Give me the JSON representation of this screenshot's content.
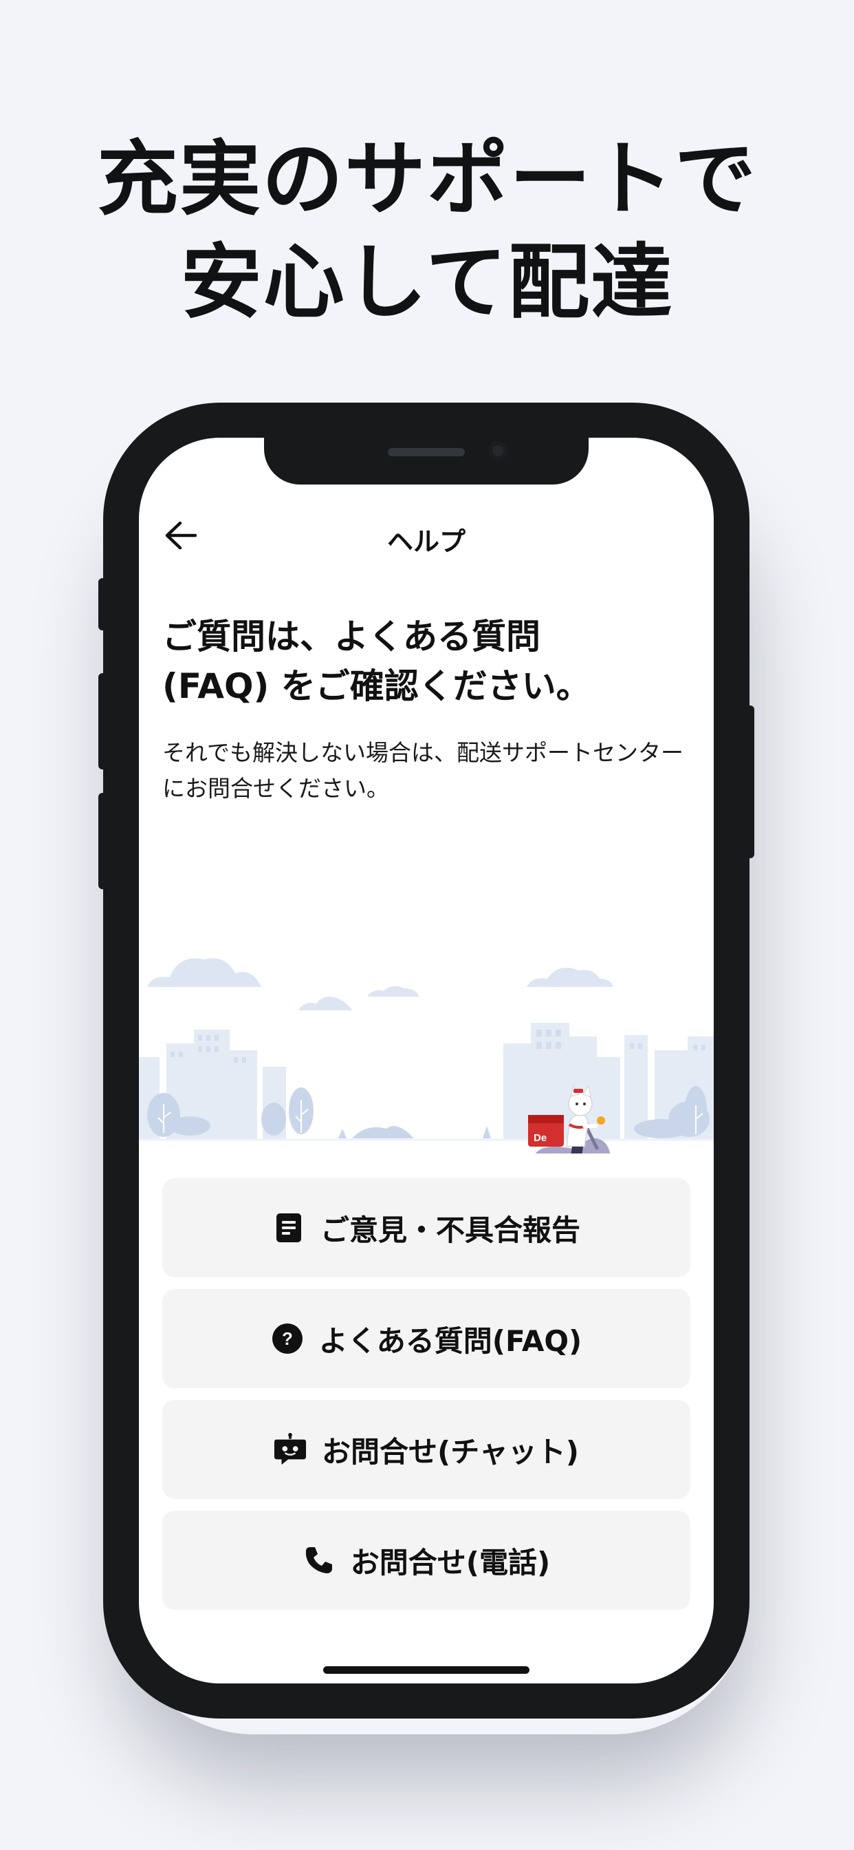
{
  "headline": {
    "line1": "充実のサポートで",
    "line2": "安心して配達"
  },
  "nav": {
    "back_icon": "arrow-left-icon",
    "title": "ヘルプ"
  },
  "content": {
    "heading": "ご質問は、よくある質問\n(FAQ) をご確認ください。",
    "subtext": "それでも解決しない場合は、配送サポートセンターにお問合せください。",
    "illustration_badge": "De"
  },
  "actions": [
    {
      "icon": "document-icon",
      "label": "ご意見・不具合報告"
    },
    {
      "icon": "question-circle-icon",
      "label": "よくある質問(FAQ)"
    },
    {
      "icon": "chat-bot-icon",
      "label": "お問合せ(チャット)"
    },
    {
      "icon": "phone-icon",
      "label": "お問合せ(電話)"
    }
  ],
  "colors": {
    "background": "#f3f4f9",
    "phone_frame": "#17191b",
    "button_bg": "#f4f4f4",
    "text": "#111111",
    "accent_red": "#d32f2f",
    "city_blue": "#dbe4f1"
  }
}
